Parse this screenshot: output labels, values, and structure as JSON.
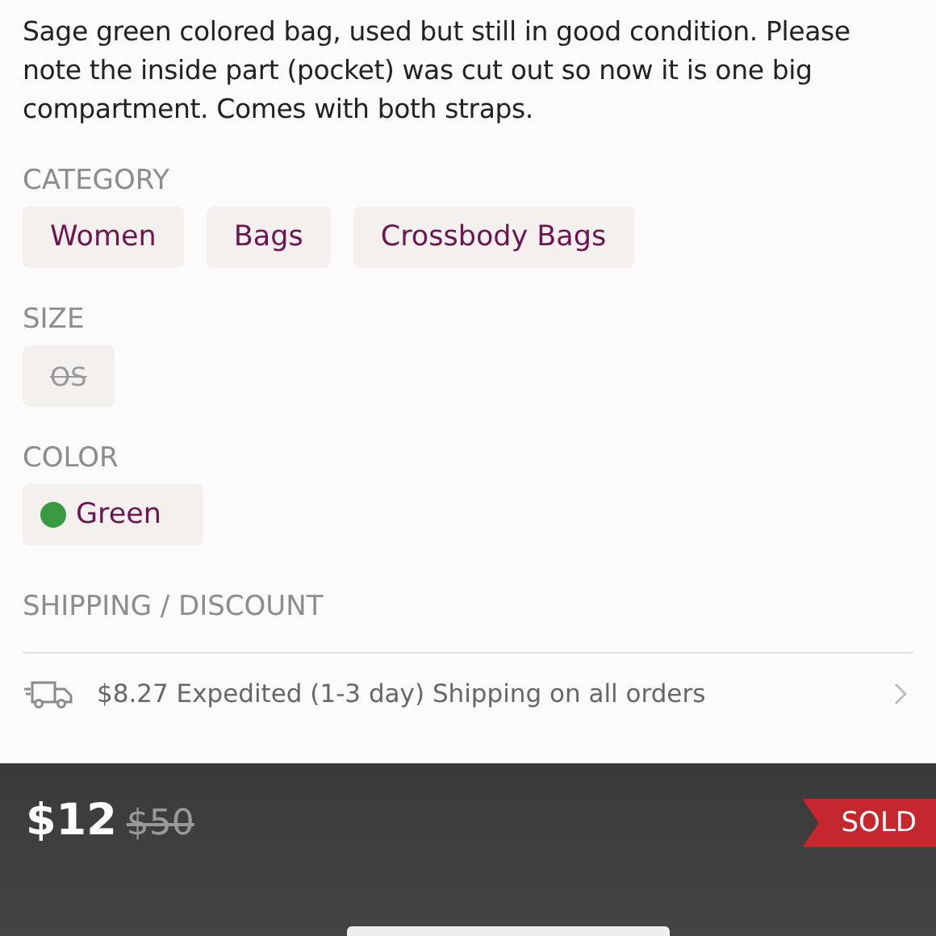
{
  "description": "Sage green colored bag, used but still in good condition. Please note the inside part (pocket) was cut out so now it is one big compartment. Comes with both straps.",
  "category": {
    "label": "CATEGORY",
    "tags": [
      "Women",
      "Bags",
      "Crossbody Bags"
    ]
  },
  "size": {
    "label": "SIZE",
    "tags": [
      {
        "text": "OS",
        "available": false
      }
    ]
  },
  "color": {
    "label": "COLOR",
    "tags": [
      {
        "text": "Green",
        "color": "#3a9a42"
      }
    ]
  },
  "shipping": {
    "label": "SHIPPING / DISCOUNT",
    "text": "$8.27 Expedited (1-3 day) Shipping on all orders"
  },
  "price": {
    "current": "$12",
    "original": "$50"
  },
  "status": {
    "kind": "sold",
    "text": "SOLD"
  }
}
